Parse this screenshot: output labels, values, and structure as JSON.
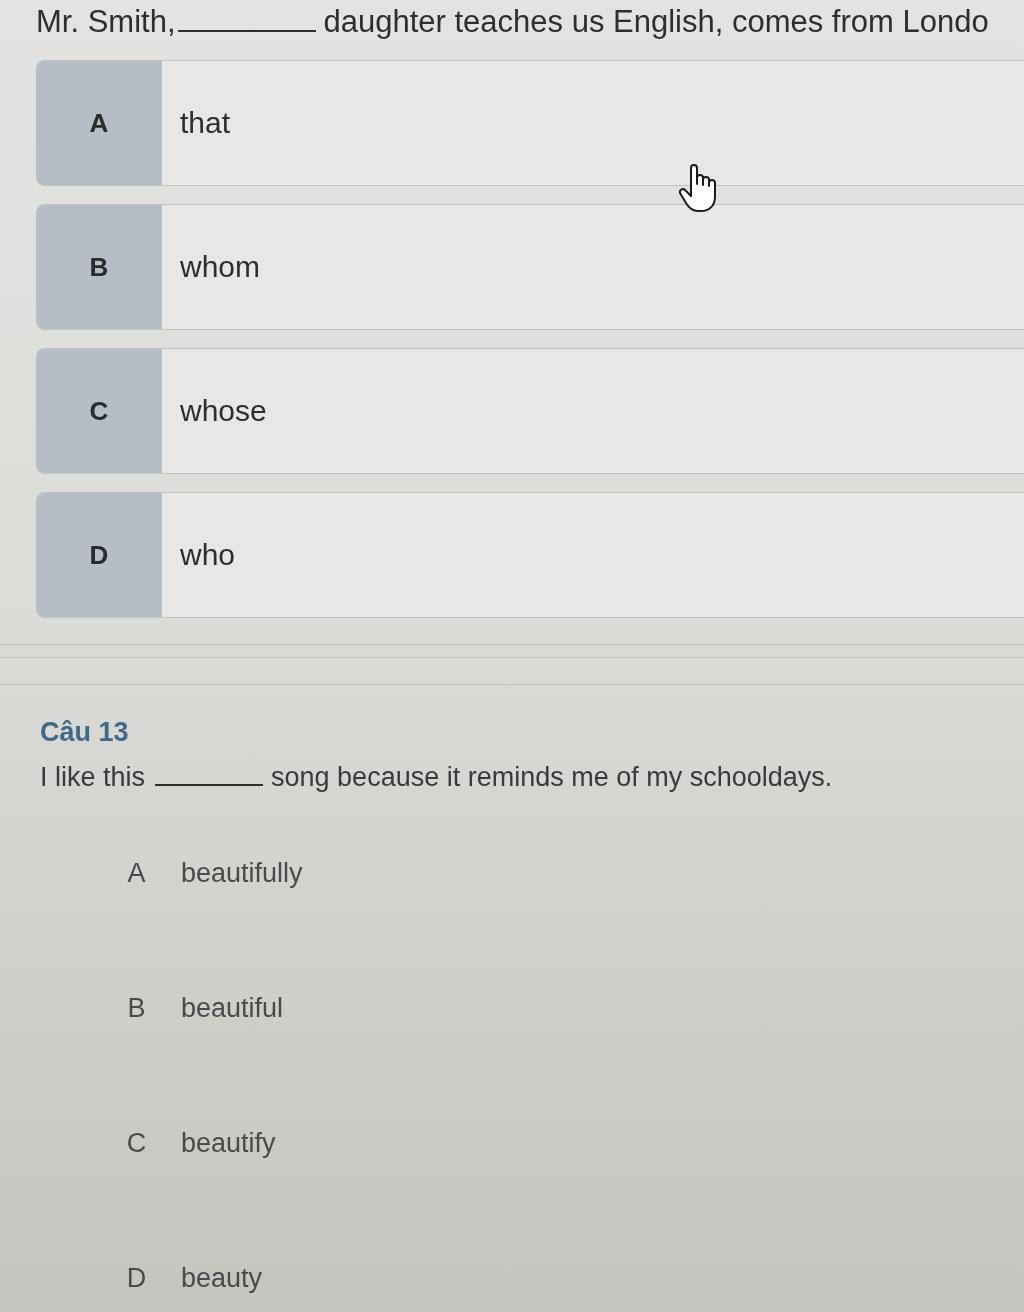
{
  "questions": [
    {
      "kind": "card",
      "text_before": "Mr. Smith,",
      "text_after": "daughter teaches us English, comes from Londo",
      "options": [
        {
          "letter": "A",
          "text": "that"
        },
        {
          "letter": "B",
          "text": "whom"
        },
        {
          "letter": "C",
          "text": "whose"
        },
        {
          "letter": "D",
          "text": "who"
        }
      ]
    },
    {
      "kind": "plain",
      "heading": "Câu 13",
      "text_before": "I like this",
      "text_after": "song because it reminds me of my schooldays.",
      "options": [
        {
          "letter": "A",
          "text": "beautifully"
        },
        {
          "letter": "B",
          "text": "beautiful"
        },
        {
          "letter": "C",
          "text": "beautify"
        },
        {
          "letter": "D",
          "text": "beauty"
        }
      ]
    }
  ]
}
